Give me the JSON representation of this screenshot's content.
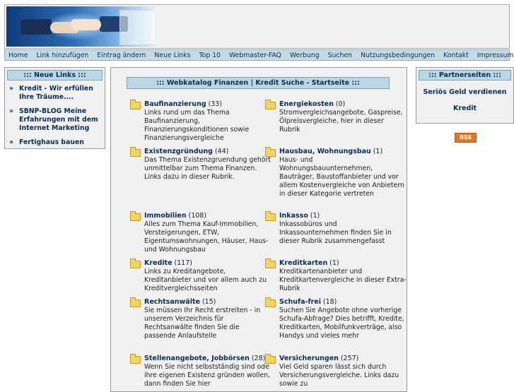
{
  "nav": [
    "Home",
    "Link hinzufügen",
    "Eintrag ändern",
    "Neue Links",
    "Top 10",
    "Webmaster-FAQ",
    "Werbung",
    "Suchen",
    "Nutzungsbedingungen",
    "Kontakt",
    "Impressum"
  ],
  "left_box": {
    "title": "::: Neue Links :::",
    "bullet": "»",
    "items": [
      "Kredit - Wir erfüllen Ihre Träume....",
      "SBNP-BLOG Meine Erfahrungen mit dem Internet Marketing",
      "Fertighaus bauen"
    ]
  },
  "main": {
    "title": "::: Webkatalog Finanzen | Kredit Suche - Startseite :::",
    "categories": [
      {
        "name": "Baufinanzierung",
        "count": "(33)",
        "desc": "Links rund um das Thema Baufinanzierung, Finanzierungskonditionen sowie Finanzierungsvergleiche"
      },
      {
        "name": "Energiekosten",
        "count": "(0)",
        "desc": "Stromvergleichsangebote, Gaspreise, Ölpreisvergleiche, hier in dieser Rubrik"
      },
      {
        "name": "Existenzgründung",
        "count": "(44)",
        "desc": "Das Thema Existenzgruendung gehört unmittelbar zum Thema Finanzen. Links dazu in dieser Rubrik."
      },
      {
        "name": "Hausbau, Wohnungsbau",
        "count": "(1)",
        "desc": "Haus- und Wohnungsbauunternehmen, Bauträger, Baustoffanbieter und vor allem Kostenvergleiche von Anbietern in dieser Kategorie vertreten"
      },
      {
        "name": "Immobilien",
        "count": "(108)",
        "desc": "Alles zum Thema Kauf-Immobilien, Versteigerungen, ETW, Eigentumswohnungen, Häuser, Haus- und Wohnungsbau"
      },
      {
        "name": "Inkasso",
        "count": "(1)",
        "desc": "Inkassobüros und Inkassounternehmen finden Sie in dieser Rubrik zusammengefasst"
      },
      {
        "name": "Kredite",
        "count": "(117)",
        "desc": "Links zu Kreditangebote, Kreditanbieter und vor allem auch zu Kreditvergleichsseiten"
      },
      {
        "name": "Kreditkarten",
        "count": "(1)",
        "desc": "Kreditkartenanbieter und Kreditkartenvergleiche in dieser Extra-Rubrik"
      },
      {
        "name": "Rechtsanwälte",
        "count": "(15)",
        "desc": "Sie müssen Ihr Recht erstreiten - in unserem Verzeichnis für Rechtsanwälte finden Sie die passende Anlaufstelle"
      },
      {
        "name": "Schufa-frei",
        "count": "(18)",
        "desc": "Suchen Sie Angebote ohne vorherige Schufa-Abfrage? Dies betrifft, Kredite, Kreditkarten, Mobilfunkverträge, also Handys und vieles mehr"
      },
      {
        "name": "Stellenangebote, Jobbörsen",
        "count": "(28)",
        "desc": "Wenn Sie nicht selbstständig sind ode ihre eigenen Existenz gründen wollen, dann finden Sie hier"
      },
      {
        "name": "Versicherungen",
        "count": "(257)",
        "desc": "Viel Geld sparen lässt sich durch Versicherungsvergleiche. Links dazu sowie zu"
      }
    ]
  },
  "right_box": {
    "title": "::: Partnerseiten :::",
    "links": [
      "Seriös Geld verdienen",
      "Kredit"
    ]
  },
  "rss": "RSS",
  "colors": {
    "nav_bg": "#c5dbe6",
    "title_bg": "#b9d7e4",
    "link": "#0b2e55",
    "rss": "#e8781f"
  }
}
